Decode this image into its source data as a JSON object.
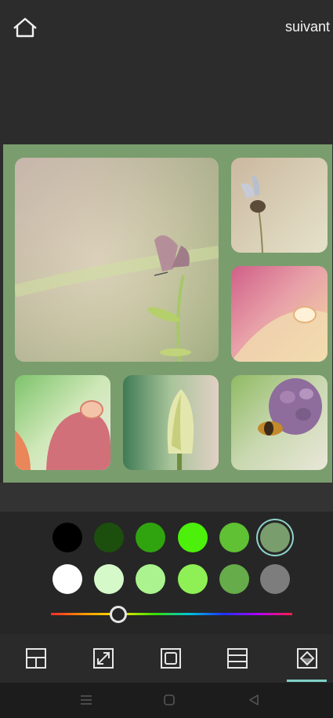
{
  "header": {
    "next_label": "suivant"
  },
  "collage": {
    "border_color": "#7a9d6e",
    "tiles": [
      "butterfly-on-grass",
      "butterfly-on-stem",
      "water-drop-on-petal",
      "drop-on-red-petal",
      "tulip-bud",
      "bee-on-grape-hyacinth"
    ]
  },
  "palette": {
    "colors_row1": [
      "#000000",
      "#1c4f0d",
      "#2fa40f",
      "#4cf00a",
      "#5fc133",
      "#7a9d6e"
    ],
    "colors_row2": [
      "#ffffff",
      "#d6f9c9",
      "#aaf38f",
      "#8ef055",
      "#66ac4a",
      "#7d7d7d"
    ],
    "selected": "#7a9d6e",
    "hue_position": 0.28
  },
  "toolbar": {
    "tools": [
      "layout-icon",
      "resize-icon",
      "border-icon",
      "spacing-icon",
      "background-color-icon"
    ],
    "active": "background-color-icon"
  },
  "nav": {
    "buttons": [
      "menu-icon",
      "home-icon",
      "back-icon"
    ]
  }
}
